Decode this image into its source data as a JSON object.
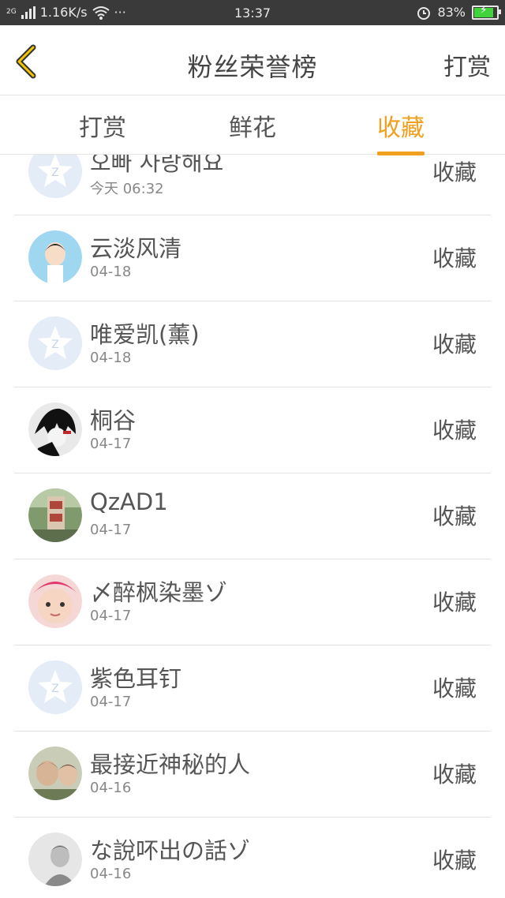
{
  "status_bar": {
    "network": "2G",
    "speed": "1.16K/s",
    "more": "···",
    "time": "13:37",
    "battery": "83%"
  },
  "header": {
    "title": "粉丝荣誉榜",
    "action": "打赏"
  },
  "tabs": [
    {
      "label": "打赏",
      "active": false
    },
    {
      "label": "鲜花",
      "active": false
    },
    {
      "label": "收藏",
      "active": true
    }
  ],
  "rows": [
    {
      "name": "오빠 사랑해요",
      "date": "今天 06:32",
      "action": "收藏",
      "avatar": "qq-default"
    },
    {
      "name": "云淡风清",
      "date": "04-18",
      "action": "收藏",
      "avatar": "cartoon-boy"
    },
    {
      "name": "唯爱凯(薰)",
      "date": "04-18",
      "action": "收藏",
      "avatar": "qq-default"
    },
    {
      "name": "桐谷",
      "date": "04-17",
      "action": "收藏",
      "avatar": "anime-dark"
    },
    {
      "name": "QzAD1",
      "date": "04-17",
      "action": "收藏",
      "avatar": "photo-stone"
    },
    {
      "name": "〆醉枫染墨ゾ",
      "date": "04-17",
      "action": "收藏",
      "avatar": "photo-child"
    },
    {
      "name": "紫色耳钉",
      "date": "04-17",
      "action": "收藏",
      "avatar": "qq-default"
    },
    {
      "name": "最接近神秘的人",
      "date": "04-16",
      "action": "收藏",
      "avatar": "photo-couple"
    },
    {
      "name": "な說吥出の話ゾ",
      "date": "04-16",
      "action": "收藏",
      "avatar": "photo-bw"
    }
  ],
  "colors": {
    "accent": "#f0a01e",
    "status_bar": "#3a3a3a",
    "divider": "#e3e3e3"
  }
}
